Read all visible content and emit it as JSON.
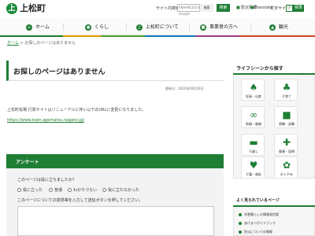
{
  "header": {
    "site_name": "上松町",
    "logo_glyph": "上",
    "search_label": "サイト内検索",
    "search_placeholder": "ENHANCED BY Google",
    "search_button_label": "検索",
    "submit_label": "検索",
    "links": [
      "防災情報",
      "Translate"
    ],
    "font_size_label": "文字サイズ",
    "font_small": "小",
    "font_large": "標準"
  },
  "nav": {
    "items": [
      {
        "label": "ホーム",
        "icon": "home-icon"
      },
      {
        "label": "くらし",
        "icon": "life-icon"
      },
      {
        "label": "上松町について",
        "icon": "town-icon"
      },
      {
        "label": "事業者の方へ",
        "icon": "business-icon"
      },
      {
        "label": "観光",
        "icon": "tourism-icon"
      }
    ]
  },
  "breadcrumb": {
    "home": "ホーム",
    "current": "お探しのページはありません"
  },
  "page": {
    "title": "お探しのページはありません",
    "updated": "更新日：2022年09月30日",
    "message": "上松町役場 行政サイトはリニューアルに伴い以下のURLに変更になりました。",
    "url": "https://www.town.agematsu.nagano.jp/"
  },
  "survey": {
    "title": "アンケート",
    "question1": "このページは役に立ちましたか？",
    "options": [
      "役に立った",
      "普通",
      "わかりづらい",
      "役に立たなかった"
    ],
    "question2": "このページについての意見等を入力して送信ボタンを押してください。"
  },
  "sidebar": {
    "title": "ライフシーンから探す",
    "tiles": [
      {
        "label": "妊娠・出産",
        "icon": "stroller-icon"
      },
      {
        "label": "子育て",
        "icon": "parent-child-icon"
      },
      {
        "label": "結婚・離婚",
        "icon": "rings-icon"
      },
      {
        "label": "就職・退職",
        "icon": "suitcase-icon"
      },
      {
        "label": "引越し",
        "icon": "truck-icon"
      },
      {
        "label": "健康・医療",
        "icon": "medical-icon"
      },
      {
        "label": "介護・福祉",
        "icon": "care-icon"
      },
      {
        "label": "おくやみ",
        "icon": "flower-icon"
      }
    ]
  },
  "popular": {
    "title": "よく見られているページ",
    "items": [
      "木曽暮らしの情報発信版",
      "あげまつガイドブック",
      "防災についての情報"
    ]
  },
  "colors": {
    "brand": "#1e7e34"
  }
}
